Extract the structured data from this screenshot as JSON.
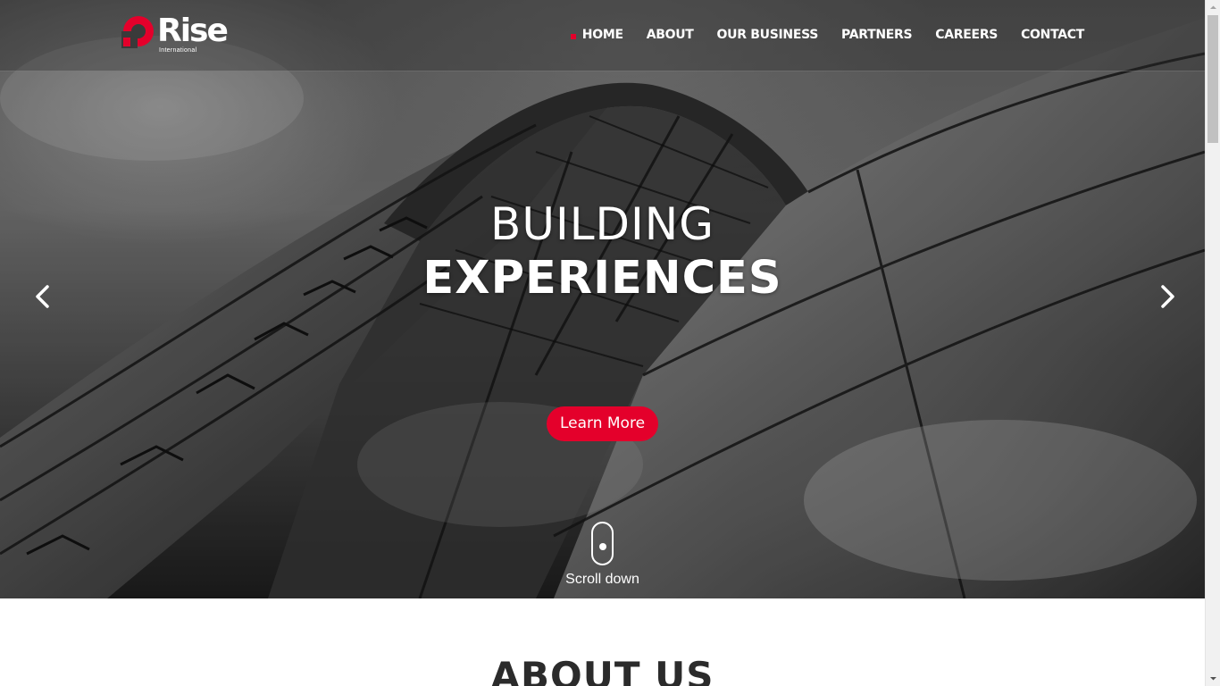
{
  "brand": {
    "name": "Rise",
    "subtitle": "International",
    "accent": "#e4002b"
  },
  "nav": {
    "items": [
      {
        "label": "HOME",
        "active": true
      },
      {
        "label": "ABOUT",
        "active": false
      },
      {
        "label": "OUR BUSINESS",
        "active": false
      },
      {
        "label": "PARTNERS",
        "active": false
      },
      {
        "label": "CAREERS",
        "active": false
      },
      {
        "label": "CONTACT",
        "active": false
      }
    ]
  },
  "hero": {
    "line1": "BUILDING",
    "line2": "EXPERIENCES",
    "cta_label": "Learn More",
    "prev_icon": "chevron-left-icon",
    "next_icon": "chevron-right-icon",
    "scroll_label": "Scroll down",
    "scroll_icon": "mouse-icon"
  },
  "about": {
    "title": "ABOUT US"
  }
}
